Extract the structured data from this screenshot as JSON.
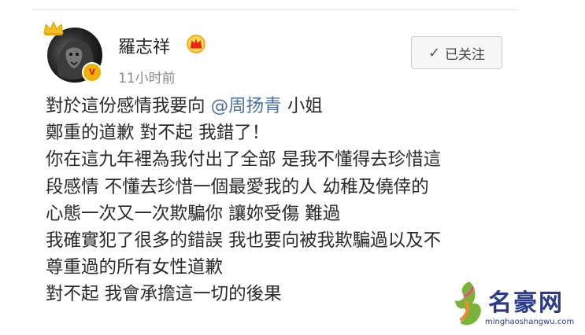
{
  "post": {
    "username": "羅志祥",
    "timestamp": "11小时前",
    "follow_button_label": "已关注",
    "verified_badge": "v",
    "content": {
      "line1_prefix": "對於這份感情我要向 ",
      "line1_mention": "@周扬青",
      "line1_suffix": " 小姐",
      "line2": "鄭重的道歉 對不起 我錯了！",
      "line3": "你在這九年裡為我付出了全部 是我不懂得去珍惜這",
      "line4": "段感情 不懂去珍惜一個最愛我的人 幼稚及僥倖的",
      "line5": "心態一次又一次欺騙你 讓妳受傷 難過",
      "line6": "我確實犯了很多的錯誤 我也要向被我欺騙過以及不",
      "line7": "尊重過的所有女性道歉",
      "line8": "對不起   我會承擔這一切的後果"
    }
  },
  "watermark": {
    "title": "名豪网",
    "url": "minghaoshangwu.com"
  },
  "icons": {
    "crown": "crown-icon",
    "vip": "vip-crown-icon",
    "check": "check-icon",
    "avatar": "lion-avatar"
  },
  "colors": {
    "mention": "#4a6fa5",
    "badge": "#f2b100",
    "watermark": "#2a3b8f"
  }
}
